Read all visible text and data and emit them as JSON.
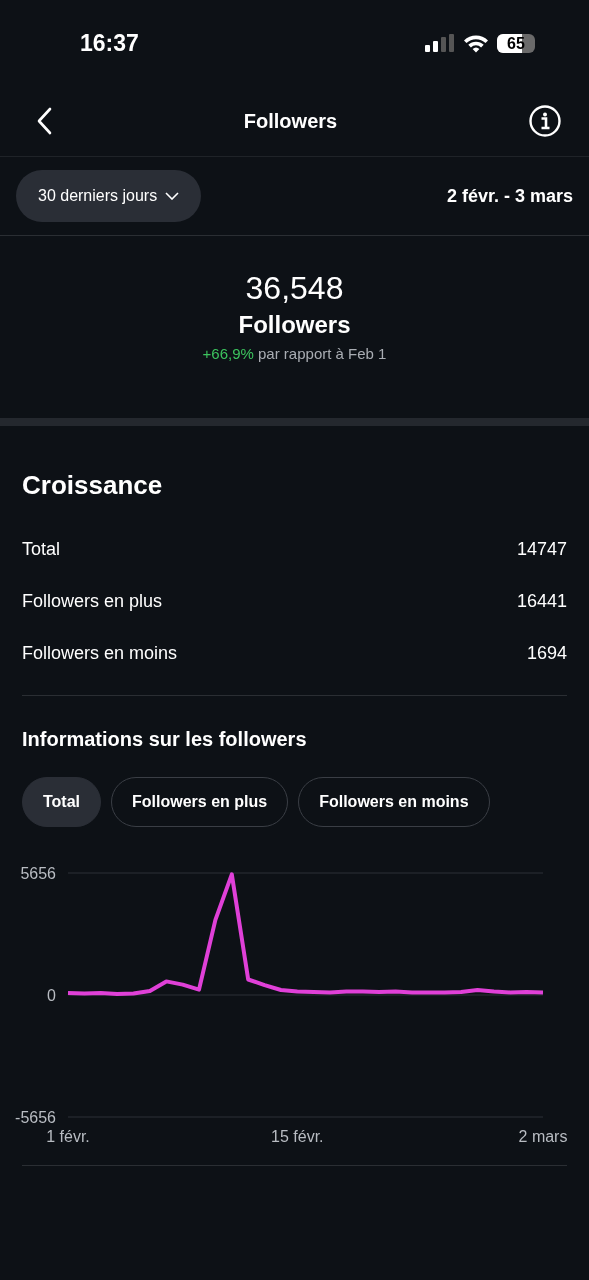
{
  "status_bar": {
    "time": "16:37",
    "battery": "65"
  },
  "header": {
    "title": "Followers"
  },
  "filter": {
    "period": "30 derniers jours",
    "range": "2 févr. - 3 mars"
  },
  "summary": {
    "count": "36,548",
    "label": "Followers",
    "change": "+66,9%",
    "comparison": "par rapport à Feb 1"
  },
  "growth": {
    "title": "Croissance",
    "rows": [
      {
        "label": "Total",
        "value": "14747"
      },
      {
        "label": "Followers en plus",
        "value": "16441"
      },
      {
        "label": "Followers en moins",
        "value": "1694"
      }
    ]
  },
  "insights": {
    "title": "Informations sur les followers",
    "chips": [
      {
        "label": "Total",
        "selected": true
      },
      {
        "label": "Followers en plus",
        "selected": false
      },
      {
        "label": "Followers en moins",
        "selected": false
      }
    ],
    "chart_data": {
      "type": "line",
      "x": [
        1,
        2,
        3,
        4,
        5,
        6,
        7,
        8,
        9,
        10,
        11,
        12,
        13,
        14,
        15,
        16,
        17,
        18,
        19,
        20,
        21,
        22,
        23,
        24,
        25,
        26,
        27,
        28,
        29,
        30
      ],
      "xlim": [
        1,
        30
      ],
      "xticks": [
        {
          "value": 1,
          "label": "1 févr."
        },
        {
          "value": 15,
          "label": "15 févr."
        },
        {
          "value": 30,
          "label": "2 mars"
        }
      ],
      "series": [
        {
          "color": "#e040d8",
          "values": [
            90,
            70,
            90,
            50,
            70,
            190,
            630,
            480,
            250,
            3480,
            5590,
            720,
            460,
            230,
            160,
            140,
            120,
            160,
            160,
            140,
            160,
            120,
            120,
            120,
            140,
            230,
            160,
            120,
            140,
            120
          ]
        }
      ],
      "ylim": [
        -5656,
        5656
      ],
      "yticks": [
        -5656,
        0,
        5656
      ]
    }
  }
}
